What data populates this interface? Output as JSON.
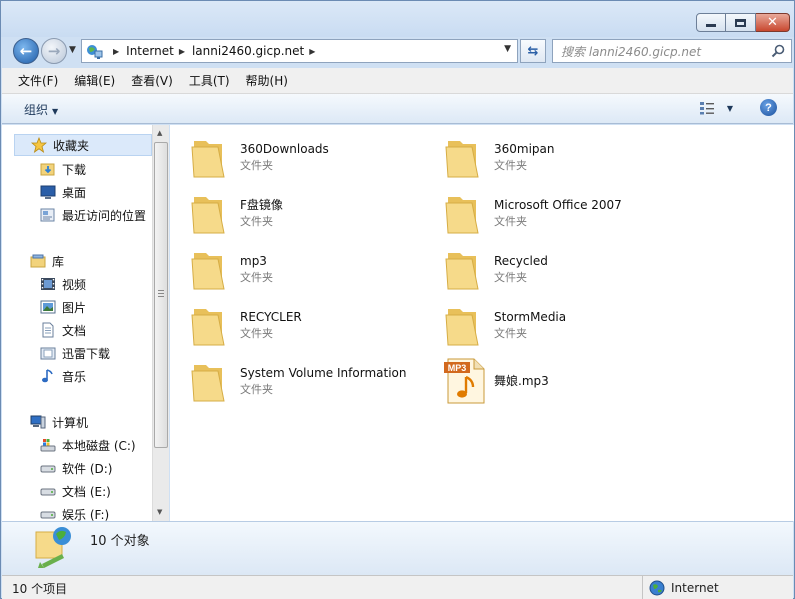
{
  "window": {
    "caption_buttons": [
      "minimize",
      "maximize",
      "close"
    ]
  },
  "nav": {
    "crumbs": [
      "Internet",
      "lanni2460.gicp.net"
    ],
    "search_placeholder": "搜索 lanni2460.gicp.net"
  },
  "menu": [
    "文件(F)",
    "编辑(E)",
    "查看(V)",
    "工具(T)",
    "帮助(H)"
  ],
  "cmd": {
    "organize": "组织"
  },
  "sidebar": {
    "favorites": {
      "label": "收藏夹",
      "items": [
        "下载",
        "桌面",
        "最近访问的位置"
      ]
    },
    "libraries": {
      "label": "库",
      "items": [
        "视频",
        "图片",
        "文档",
        "迅雷下载",
        "音乐"
      ]
    },
    "computer": {
      "label": "计算机",
      "items": [
        "本地磁盘 (C:)",
        "软件 (D:)",
        "文档 (E:)",
        "娱乐 (F:)"
      ]
    }
  },
  "files": [
    {
      "name": "360Downloads",
      "type": "文件夹",
      "kind": "folder"
    },
    {
      "name": "360mipan",
      "type": "文件夹",
      "kind": "folder"
    },
    {
      "name": "F盘镜像",
      "type": "文件夹",
      "kind": "folder"
    },
    {
      "name": "Microsoft Office 2007",
      "type": "文件夹",
      "kind": "folder"
    },
    {
      "name": "mp3",
      "type": "文件夹",
      "kind": "folder"
    },
    {
      "name": "Recycled",
      "type": "文件夹",
      "kind": "folder"
    },
    {
      "name": "RECYCLER",
      "type": "文件夹",
      "kind": "folder"
    },
    {
      "name": "StormMedia",
      "type": "文件夹",
      "kind": "folder"
    },
    {
      "name": "System Volume Information",
      "type": "文件夹",
      "kind": "folder"
    },
    {
      "name": "舞娘.mp3",
      "type": "",
      "kind": "mp3",
      "badge": "MP3"
    }
  ],
  "details": {
    "count": "10 个对象"
  },
  "status": {
    "items": "10 个项目",
    "zone": "Internet"
  },
  "colors": {
    "accent": "#1e5ca8",
    "folder": "#f2d37c",
    "titlebar": "#cfe0f3"
  }
}
